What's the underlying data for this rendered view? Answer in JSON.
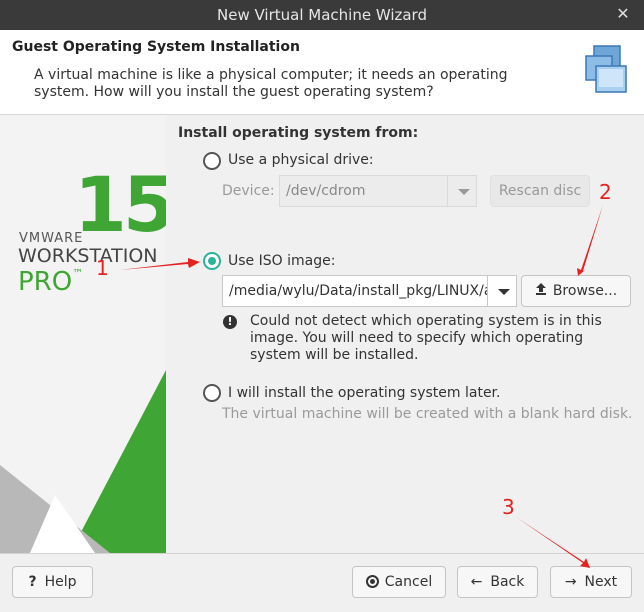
{
  "window": {
    "title": "New Virtual Machine Wizard"
  },
  "header": {
    "title": "Guest Operating System Installation",
    "description": "A virtual machine is like a physical computer; it needs an operating system. How will you install the guest operating system?"
  },
  "branding": {
    "number": "15",
    "vmware": "VMWARE",
    "workstation": "WORKSTATION",
    "pro": "PRO",
    "tm": "™"
  },
  "install": {
    "section_label": "Install operating system from:",
    "physical": {
      "label": "Use a physical drive:",
      "checked": false,
      "device_label": "Device:",
      "device_value": "/dev/cdrom",
      "rescan_label": "Rescan disc"
    },
    "iso": {
      "label": "Use ISO image:",
      "checked": true,
      "path_value": "/media/wylu/Data/install_pkg/LINUX/a",
      "browse_label": "Browse...",
      "warning": "Could not detect which operating system is in this image. You will need to specify which operating system will be installed."
    },
    "later": {
      "label": "I will install the operating system later.",
      "checked": false,
      "description": "The virtual machine will be created with a blank hard disk."
    }
  },
  "footer": {
    "help_label": "Help",
    "cancel_label": "Cancel",
    "back_label": "Back",
    "next_label": "Next"
  },
  "annotations": {
    "step1": "1",
    "step2": "2",
    "step3": "3"
  },
  "colors": {
    "accent": "#2db29a",
    "brand_green": "#3fa535",
    "annotation": "#e52222",
    "titlebar": "#3a3a3a"
  }
}
